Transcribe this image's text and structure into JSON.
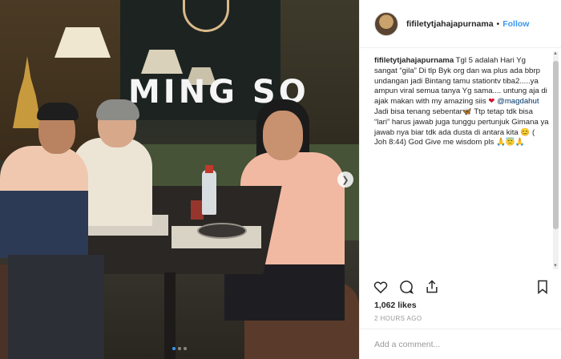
{
  "photo": {
    "sign_text": "MING SO",
    "next_arrow_icon": "chevron-right-icon",
    "dots_count": 3,
    "active_dot": 0
  },
  "header": {
    "username": "fifiletytjahajapurnama",
    "separator": "•",
    "follow_label": "Follow"
  },
  "caption": {
    "username": "fifiletytjahajapurnama",
    "text_1": " Tgl 5 adalah Hari Yg sangat “gila” Di tlp Byk org dan wa plus ada bbrp undangan jadi Bintang tamu stationtv tiba2.....ya ampun viral semua tanya Yg sama.... untung aja di ajak makan with my amazing siis ",
    "heart_emoji": "❤",
    "mention": "@magdahut",
    "text_2": " Jadi bisa tenang sebentar",
    "butterfly_emoji": "🦋",
    "text_3": " Ttp tetap tdk bisa “lari” harus jawab juga tunggu pertunjuk Gimana ya jawab nya biar tdk ada dusta di antara kita ",
    "smile_emoji": "😊",
    "text_4": " ( Joh 8:44) God Give me wisdom pls ",
    "end_emojis": "🙏😇🙏"
  },
  "actions": {
    "like_icon": "heart-icon",
    "comment_icon": "comment-icon",
    "share_icon": "share-icon",
    "save_icon": "bookmark-icon"
  },
  "likes_text": "1,062 likes",
  "time_text": "2 HOURS AGO",
  "comment_placeholder": "Add a comment..."
}
